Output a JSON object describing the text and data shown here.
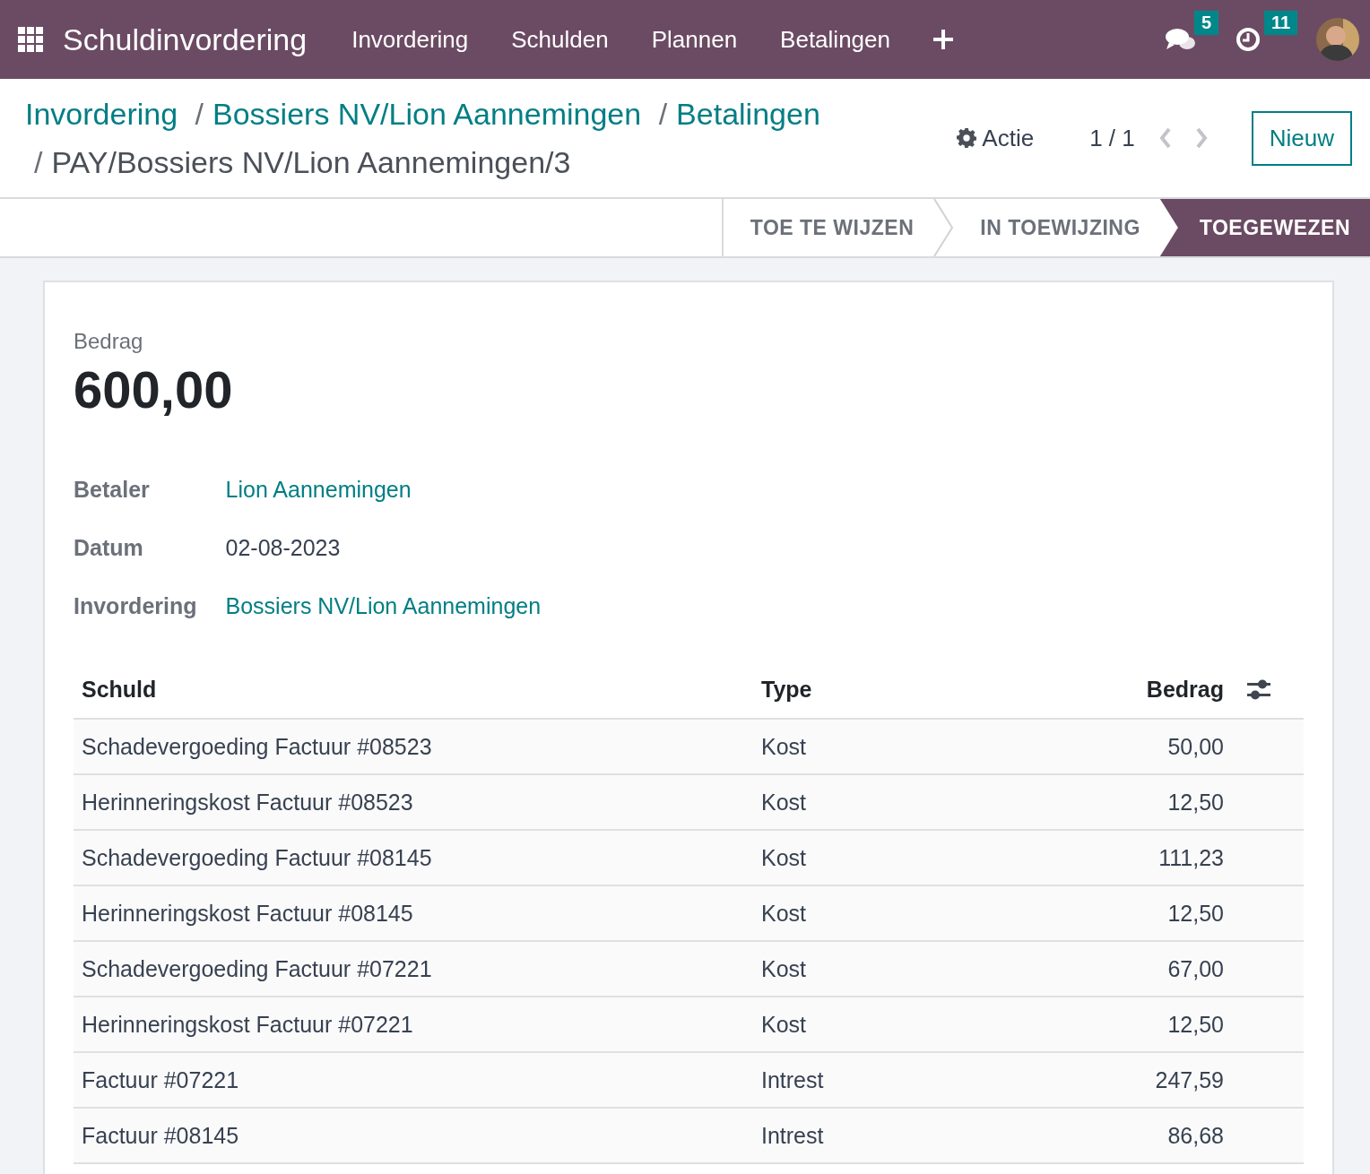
{
  "navbar": {
    "app_name": "Schuldinvordering",
    "menu": [
      "Invordering",
      "Schulden",
      "Plannen",
      "Betalingen"
    ],
    "messages_count": "5",
    "activities_count": "11"
  },
  "breadcrumbs": [
    {
      "label": "Invordering",
      "link": true
    },
    {
      "prefix": "/",
      "label": "Bossiers NV/Lion Aannemingen",
      "link": true
    },
    {
      "prefix": "/",
      "label": "Betalingen",
      "link": true
    },
    {
      "prefix": "/",
      "label": "PAY/Bossiers NV/Lion Aannemingen/3",
      "link": false
    }
  ],
  "action_label": "Actie",
  "pager": "1 / 1",
  "new_button": "Nieuw",
  "stages": [
    {
      "label": "TOE TE WIJZEN",
      "selected": false
    },
    {
      "label": "IN TOEWIJZING",
      "selected": false
    },
    {
      "label": "TOEGEWEZEN",
      "selected": true
    }
  ],
  "form": {
    "amount_label": "Bedrag",
    "amount": "600,00",
    "fields": [
      {
        "label": "Betaler",
        "value": "Lion Aannemingen",
        "kind": "link"
      },
      {
        "label": "Datum",
        "value": "02-08-2023",
        "kind": "text"
      },
      {
        "label": "Invordering",
        "value": "Bossiers NV/Lion Aannemingen",
        "kind": "link"
      }
    ]
  },
  "table": {
    "columns": [
      "Schuld",
      "Type",
      "Bedrag"
    ],
    "rows": [
      {
        "cells": [
          "Schadevergoeding Factuur #08523",
          "Kost",
          "50,00"
        ]
      },
      {
        "cells": [
          "Herinneringskost Factuur #08523",
          "Kost",
          "12,50"
        ]
      },
      {
        "cells": [
          "Schadevergoeding Factuur #08145",
          "Kost",
          "111,23"
        ]
      },
      {
        "cells": [
          "Herinneringskost Factuur #08145",
          "Kost",
          "12,50"
        ]
      },
      {
        "cells": [
          "Schadevergoeding Factuur #07221",
          "Kost",
          "67,00"
        ]
      },
      {
        "cells": [
          "Herinneringskost Factuur #07221",
          "Kost",
          "12,50"
        ]
      },
      {
        "cells": [
          "Factuur #07221",
          "Intrest",
          "247,59"
        ]
      },
      {
        "cells": [
          "Factuur #08145",
          "Intrest",
          "86,68"
        ]
      }
    ]
  }
}
